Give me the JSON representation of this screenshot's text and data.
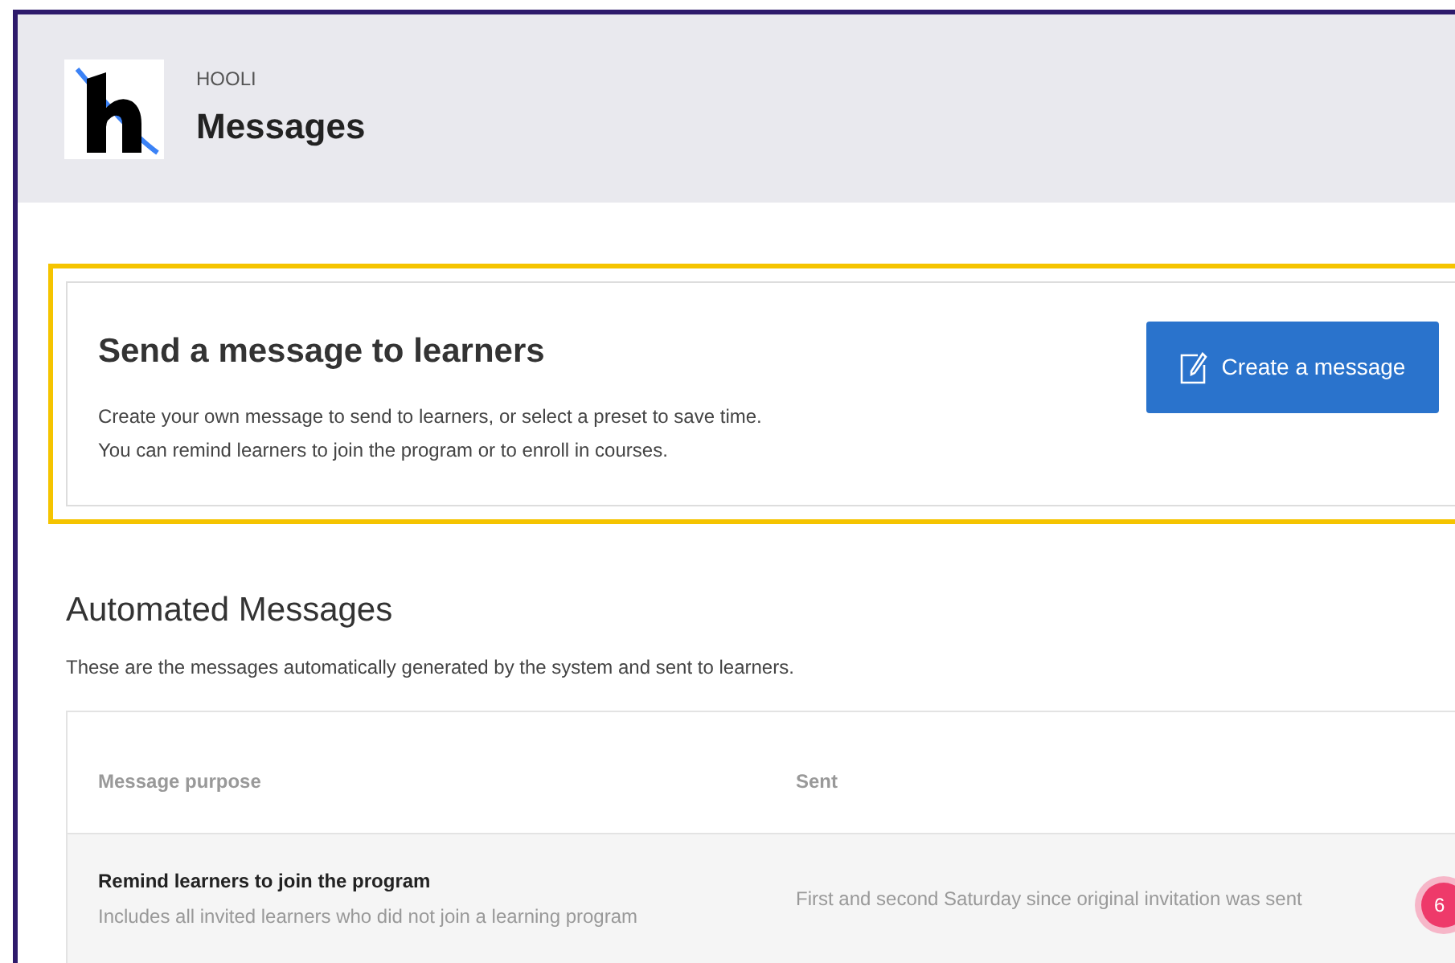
{
  "header": {
    "org": "HOOLI",
    "title": "Messages"
  },
  "send_card": {
    "title": "Send a message to learners",
    "lines": [
      "Create your own message to send to learners, or select a preset to save time.",
      "You can remind learners to join the program or to enroll in courses."
    ],
    "button": "Create a message"
  },
  "automated": {
    "title": "Automated Messages",
    "description": "These are the messages automatically generated by the system and sent to learners.",
    "table": {
      "columns": [
        "Message purpose",
        "Sent"
      ],
      "rows": [
        {
          "title": "Remind learners to join the program",
          "subtitle": "Includes all invited learners who did not join a learning program",
          "sent": "First and second Saturday since original invitation was sent"
        }
      ]
    }
  },
  "badge": "6"
}
